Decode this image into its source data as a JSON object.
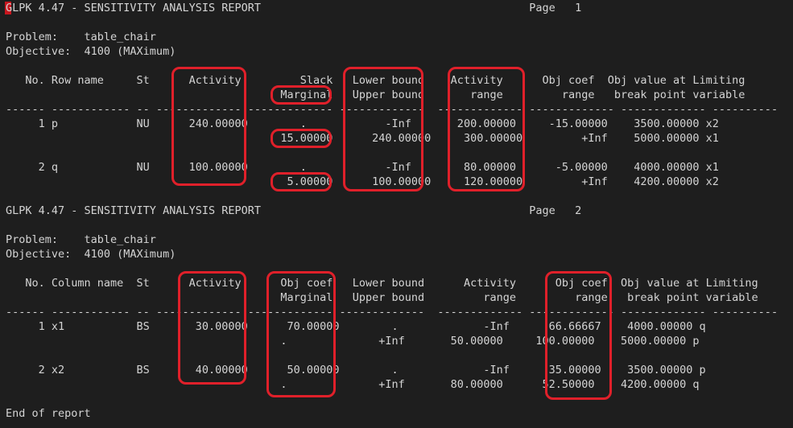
{
  "terminal": {
    "lines": [
      "GLPK 4.47 - SENSITIVITY ANALYSIS REPORT                                         Page   1",
      "",
      "Problem:    table_chair",
      "Objective:  4100 (MAXimum)",
      "",
      "   No. Row name     St      Activity         Slack   Lower bound    Activity      Obj coef  Obj value at Limiting",
      "                                          Marginal   Upper bound       range         range   break point variable",
      "------ ------------ -- ------------- ------------- -------------  ------------- ------------- ------------- ----------",
      "     1 p            NU      240.00000        .            -Inf       200.00000     -15.00000    3500.00000 x2",
      "                                          15.00000      240.00000     300.00000         +Inf    5000.00000 x1",
      "",
      "     2 q            NU      100.00000        .            -Inf        80.00000      -5.00000    4000.00000 x1",
      "                                           5.00000      100.00000     120.00000         +Inf    4200.00000 x2",
      "",
      "GLPK 4.47 - SENSITIVITY ANALYSIS REPORT                                         Page   2",
      "",
      "Problem:    table_chair",
      "Objective:  4100 (MAXimum)",
      "",
      "   No. Column name  St      Activity      Obj coef   Lower bound      Activity      Obj coef  Obj value at Limiting",
      "                                          Marginal   Upper bound         range         range   break point variable",
      "------ ------------ -- ------------- ------------- -------------  ------------- ------------- ------------- ----------",
      "     1 x1           BS       30.00000      70.00000        .             -Inf      66.66667    4000.00000 q",
      "                                          .              +Inf       50.00000     100.00000    5000.00000 p",
      "",
      "     2 x2           BS       40.00000      50.00000        .             -Inf      35.00000    3500.00000 p",
      "                                          .              +Inf       80.00000      52.50000    4200.00000 q",
      "",
      "End of report"
    ]
  },
  "colors": {
    "background": "#1e1e1e",
    "text": "#d4d4d4",
    "highlight": "#e0202a"
  }
}
